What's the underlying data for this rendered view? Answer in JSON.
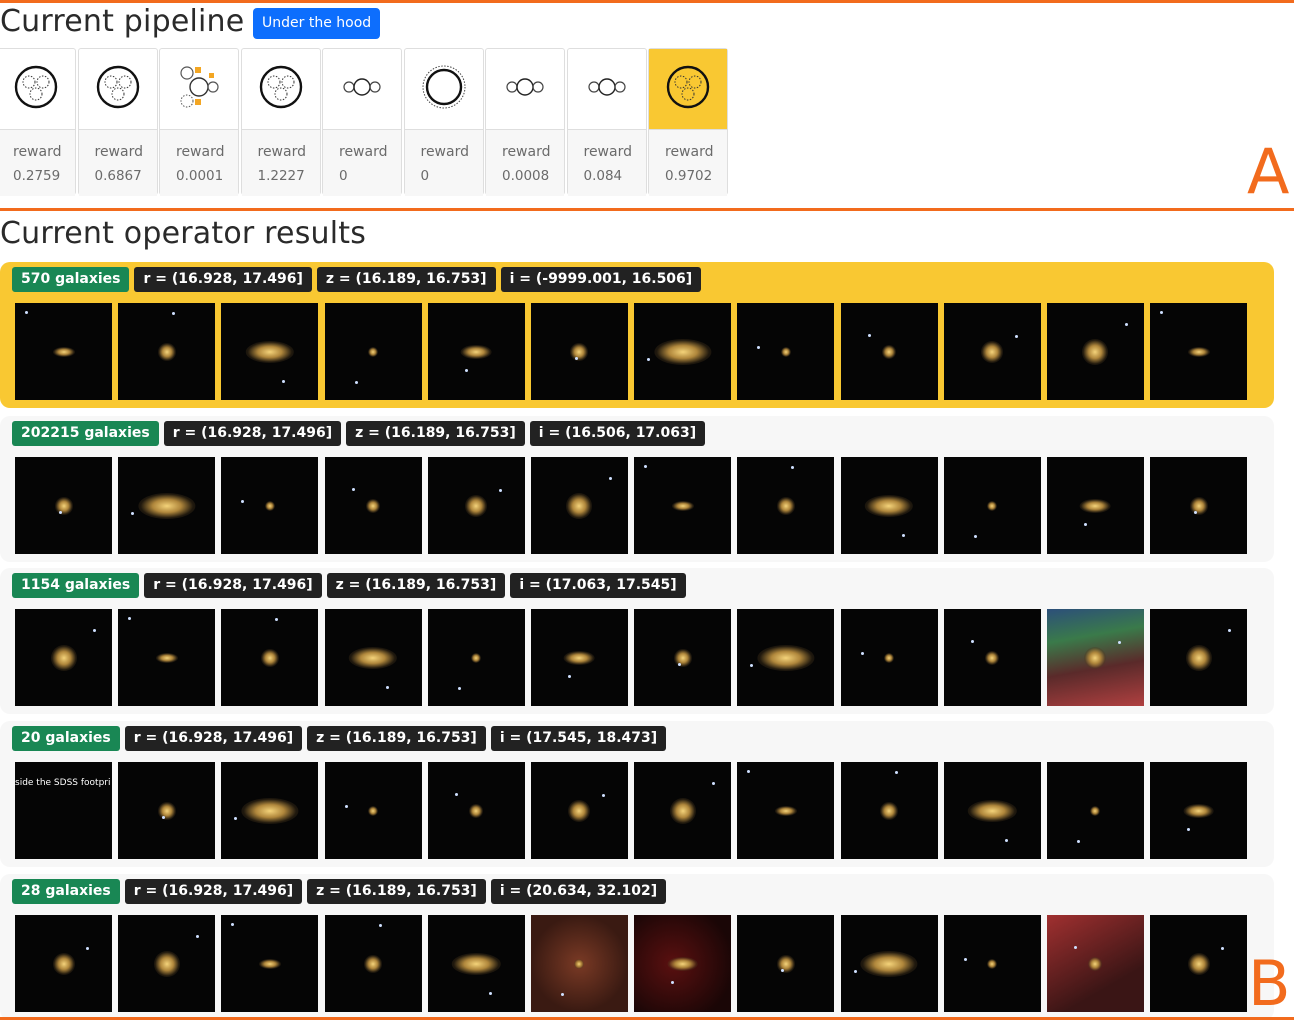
{
  "pipeline": {
    "title": "Current pipeline",
    "button_label": "Under the hood",
    "panel_letter": "A",
    "operators": [
      {
        "icon": "circle-cluster-icon",
        "label": "reward",
        "value": "0.2759",
        "active": false
      },
      {
        "icon": "circle-cluster-icon",
        "label": "reward",
        "value": "0.6867",
        "active": false
      },
      {
        "icon": "split-circles-icon",
        "label": "reward",
        "value": "0.0001",
        "active": false
      },
      {
        "icon": "circle-cluster-icon",
        "label": "reward",
        "value": "1.2227",
        "active": false
      },
      {
        "icon": "three-circles-icon",
        "label": "reward",
        "value": "0",
        "active": false
      },
      {
        "icon": "ring-circle-icon",
        "label": "reward",
        "value": "0",
        "active": false
      },
      {
        "icon": "three-circles-icon",
        "label": "reward",
        "value": "0.0008",
        "active": false
      },
      {
        "icon": "three-circles-icon",
        "label": "reward",
        "value": "0.084",
        "active": false
      },
      {
        "icon": "circle-cluster-icon",
        "label": "reward",
        "value": "0.9702",
        "active": true
      }
    ]
  },
  "results": {
    "title": "Current operator results",
    "panel_letter": "B",
    "rows": [
      {
        "count": "570 galaxies",
        "r": "r = (16.928, 17.496]",
        "z": "z = (16.189, 16.753]",
        "i": "i = (-9999.001, 16.506]",
        "active": true
      },
      {
        "count": "202215 galaxies",
        "r": "r = (16.928, 17.496]",
        "z": "z = (16.189, 16.753]",
        "i": "i = (16.506, 17.063]",
        "active": false
      },
      {
        "count": "1154 galaxies",
        "r": "r = (16.928, 17.496]",
        "z": "z = (16.189, 16.753]",
        "i": "i = (17.063, 17.545]",
        "active": false
      },
      {
        "count": "20 galaxies",
        "r": "r = (16.928, 17.496]",
        "z": "z = (16.189, 16.753]",
        "i": "i = (17.545, 18.473]",
        "active": false
      },
      {
        "count": "28 galaxies",
        "r": "r = (16.928, 17.496]",
        "z": "z = (16.189, 16.753]",
        "i": "i = (20.634, 32.102]",
        "active": false
      }
    ],
    "outside_footprint_text": "side the SDSS footpri"
  }
}
